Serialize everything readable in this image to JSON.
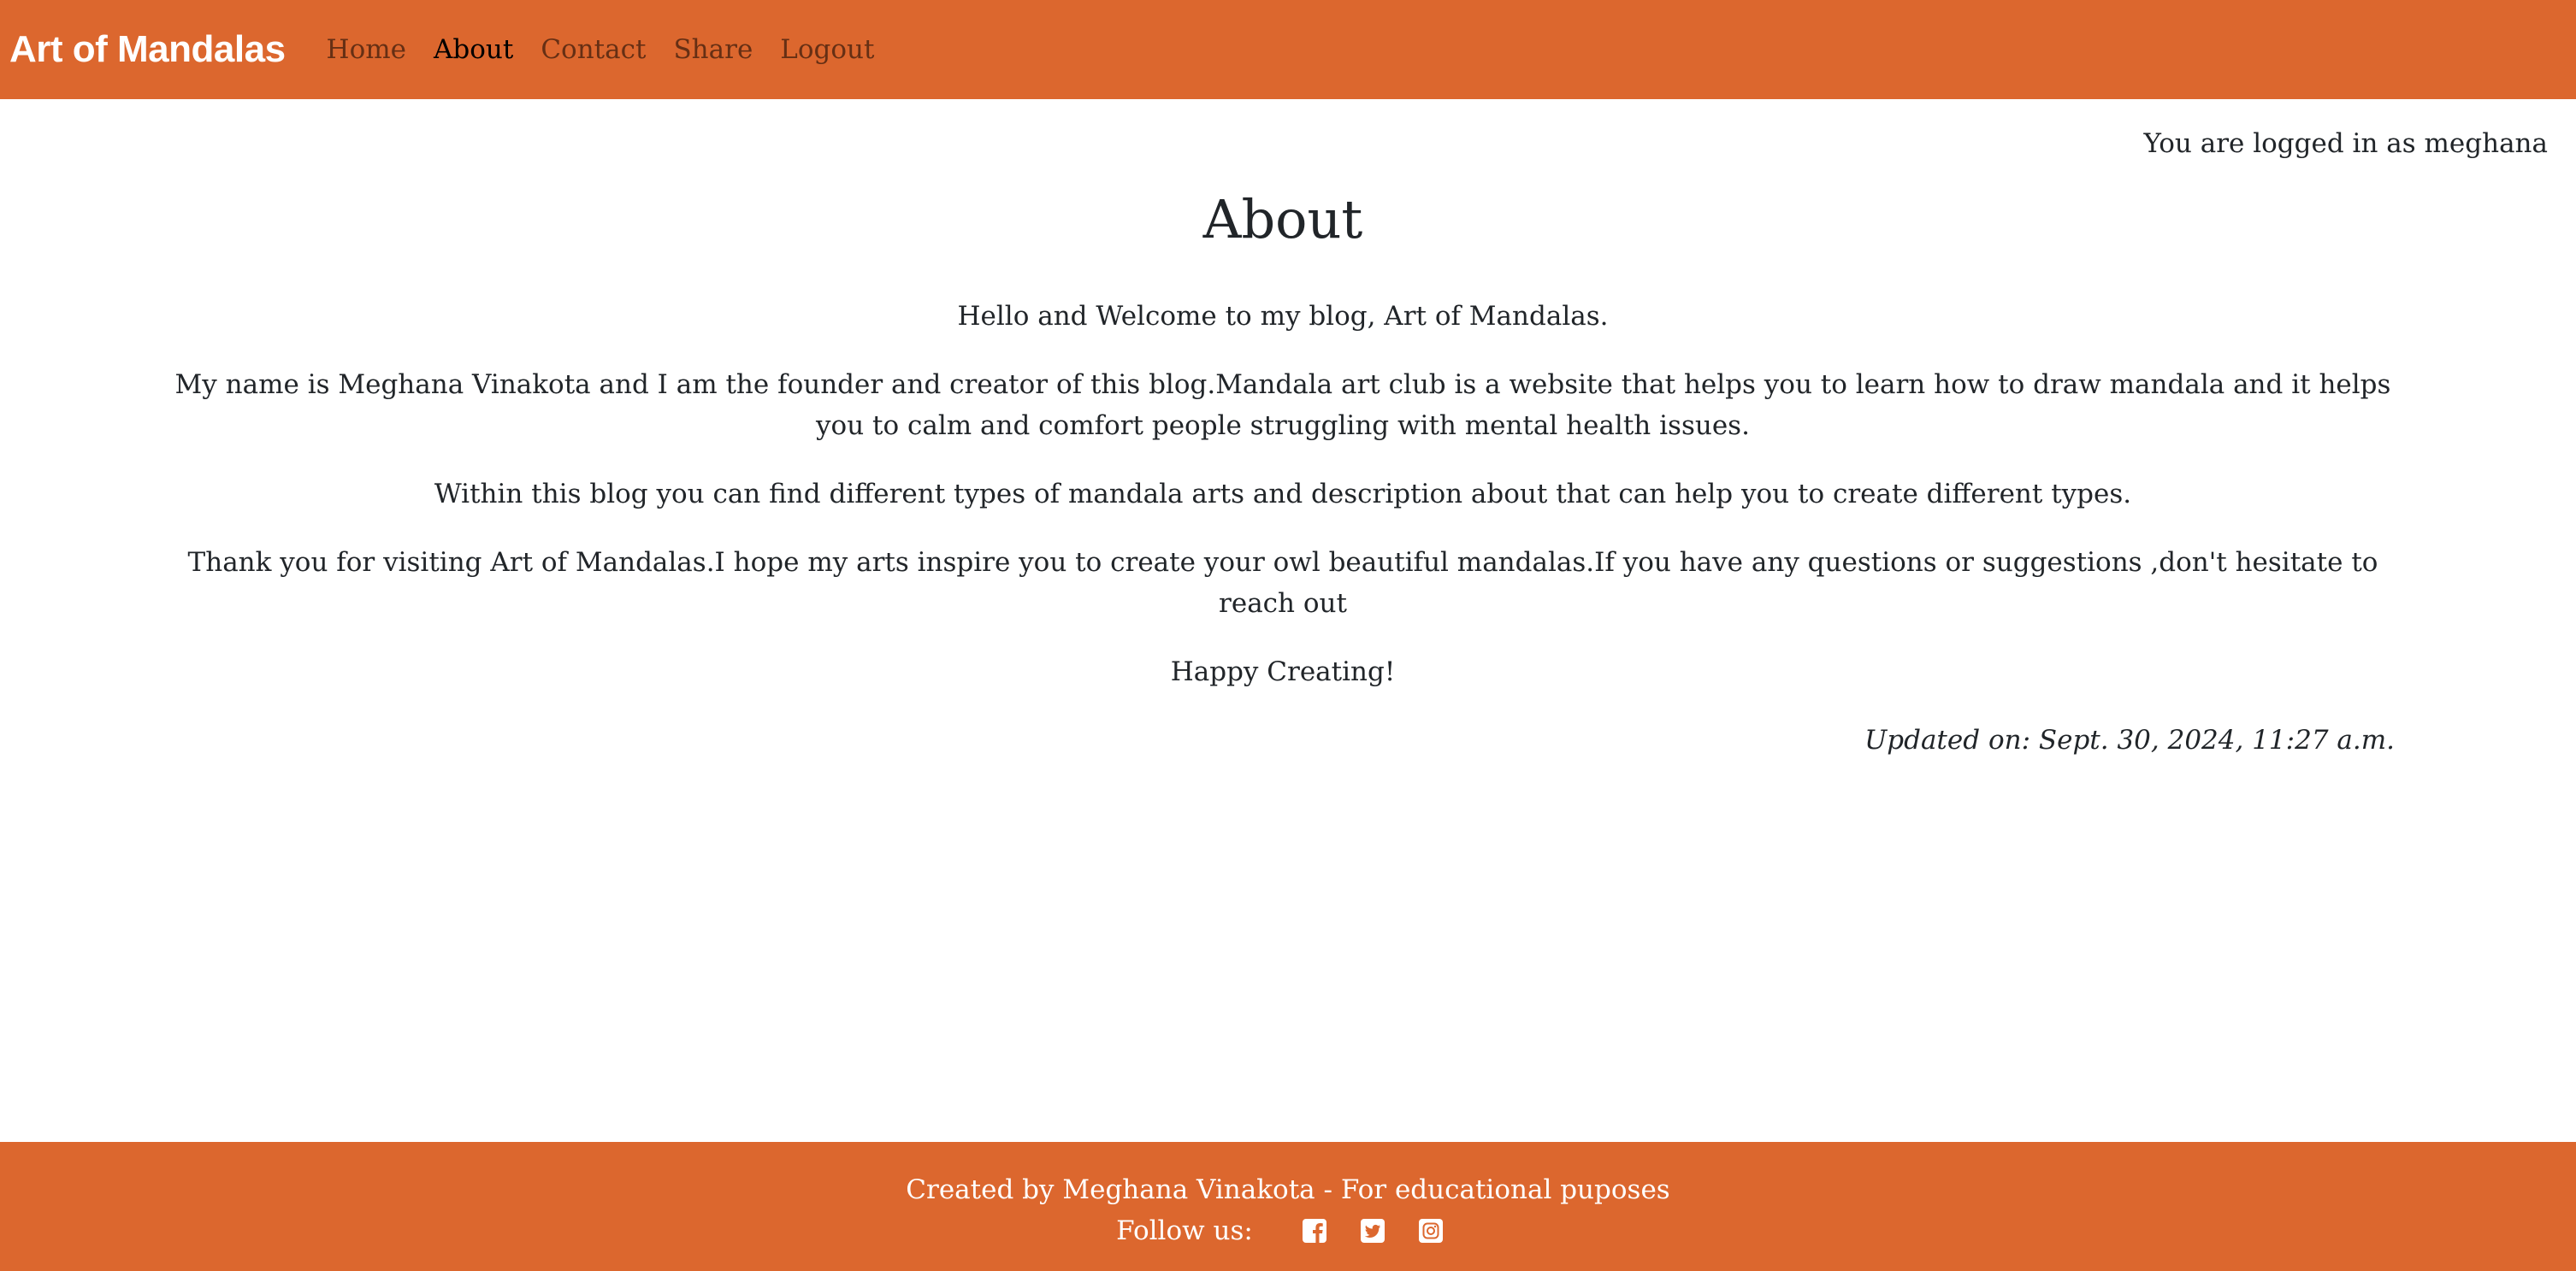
{
  "theme": {
    "accent": "#dc672e",
    "text": "#212529"
  },
  "navbar": {
    "brand": "Art of Mandalas",
    "links": [
      {
        "label": "Home",
        "active": false
      },
      {
        "label": "About",
        "active": true
      },
      {
        "label": "Contact",
        "active": false
      },
      {
        "label": "Share",
        "active": false
      },
      {
        "label": "Logout",
        "active": false
      }
    ]
  },
  "login_status": "You are logged in as meghana",
  "main": {
    "title": "About",
    "paragraphs": [
      "Hello and Welcome to my blog, Art of Mandalas.",
      "My name is Meghana Vinakota and I am the founder and creator of this blog.Mandala art club is a website that helps you to learn how to draw mandala and it helps you to calm and comfort people struggling with mental health  issues.",
      "Within this blog you can find different types of mandala arts and description about that can help you to create different types.",
      "Thank you for visiting Art of Mandalas.I hope my arts inspire you to create your owl beautiful mandalas.If you have any questions or suggestions ,don't hesitate to reach out",
      "Happy Creating!"
    ],
    "updated": "Updated on: Sept. 30, 2024, 11:27 a.m."
  },
  "footer": {
    "credit": "Created by Meghana Vinakota - For educational puposes",
    "follow_label": "Follow us:",
    "social_icons": [
      "facebook-icon",
      "twitter-icon",
      "instagram-icon"
    ]
  }
}
